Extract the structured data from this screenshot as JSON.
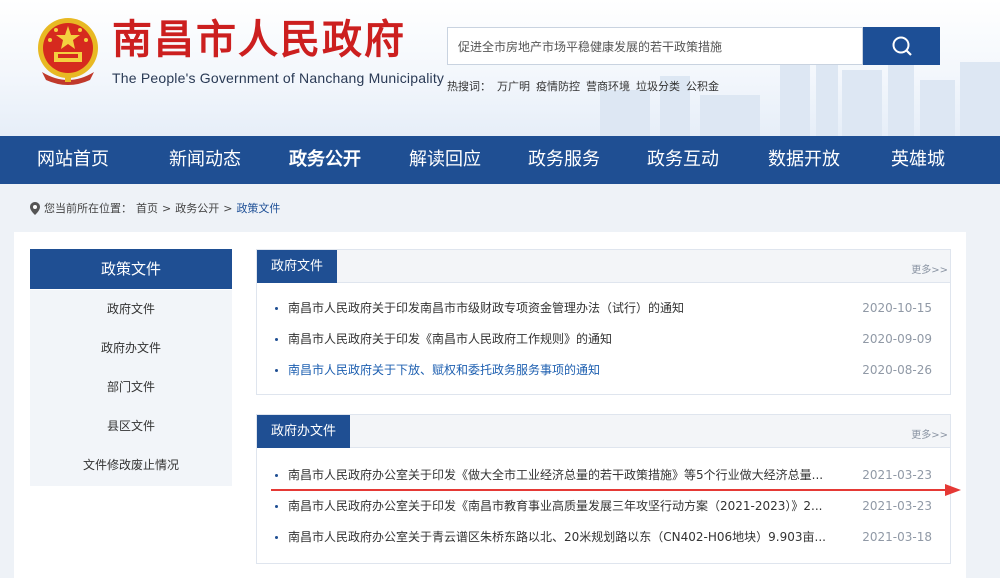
{
  "header": {
    "title": "南昌市人民政府",
    "subtitle": "The People's Government of Nanchang Municipality",
    "search_value": "促进全市房地产市场平稳健康发展的若干政策措施",
    "hot_label": "热搜词：",
    "hot_words": [
      "万广明",
      "疫情防控",
      "营商环境",
      "垃圾分类",
      "公积金"
    ]
  },
  "nav": {
    "items": [
      "网站首页",
      "新闻动态",
      "政务公开",
      "解读回应",
      "政务服务",
      "政务互动",
      "数据开放",
      "英雄城"
    ],
    "active_index": 2
  },
  "breadcrumb": {
    "prefix": "您当前所在位置：",
    "items": [
      "首页",
      "政务公开",
      "政策文件"
    ],
    "separator": ">"
  },
  "sidebar": {
    "title": "政策文件",
    "items": [
      "政府文件",
      "政府办文件",
      "部门文件",
      "县区文件",
      "文件修改废止情况"
    ]
  },
  "panels": [
    {
      "tab": "政府文件",
      "more": "更多>>",
      "rows": [
        {
          "title": "南昌市人民政府关于印发南昌市市级财政专项资金管理办法（试行）的通知",
          "date": "2020-10-15",
          "link": false
        },
        {
          "title": "南昌市人民政府关于印发《南昌市人民政府工作规则》的通知",
          "date": "2020-09-09",
          "link": false
        },
        {
          "title": "南昌市人民政府关于下放、赋权和委托政务服务事项的通知",
          "date": "2020-08-26",
          "link": true
        }
      ]
    },
    {
      "tab": "政府办文件",
      "more": "更多>>",
      "rows": [
        {
          "title": "南昌市人民政府办公室关于印发《做大全市工业经济总量的若干政策措施》等5个行业做大经济总量...",
          "date": "2021-03-23",
          "link": false
        },
        {
          "title": "南昌市人民政府办公室关于印发《南昌市教育事业高质量发展三年攻坚行动方案（2021-2023）》2...",
          "date": "2021-03-23",
          "link": false
        },
        {
          "title": "南昌市人民政府办公室关于青云谱区朱桥东路以北、20米规划路以东（CN402-H06地块）9.903亩...",
          "date": "2021-03-18",
          "link": false
        }
      ]
    }
  ],
  "colors": {
    "brand_red": "#cc1f1f",
    "nav_blue": "#1f4f93",
    "arrow_red": "#e53935"
  }
}
